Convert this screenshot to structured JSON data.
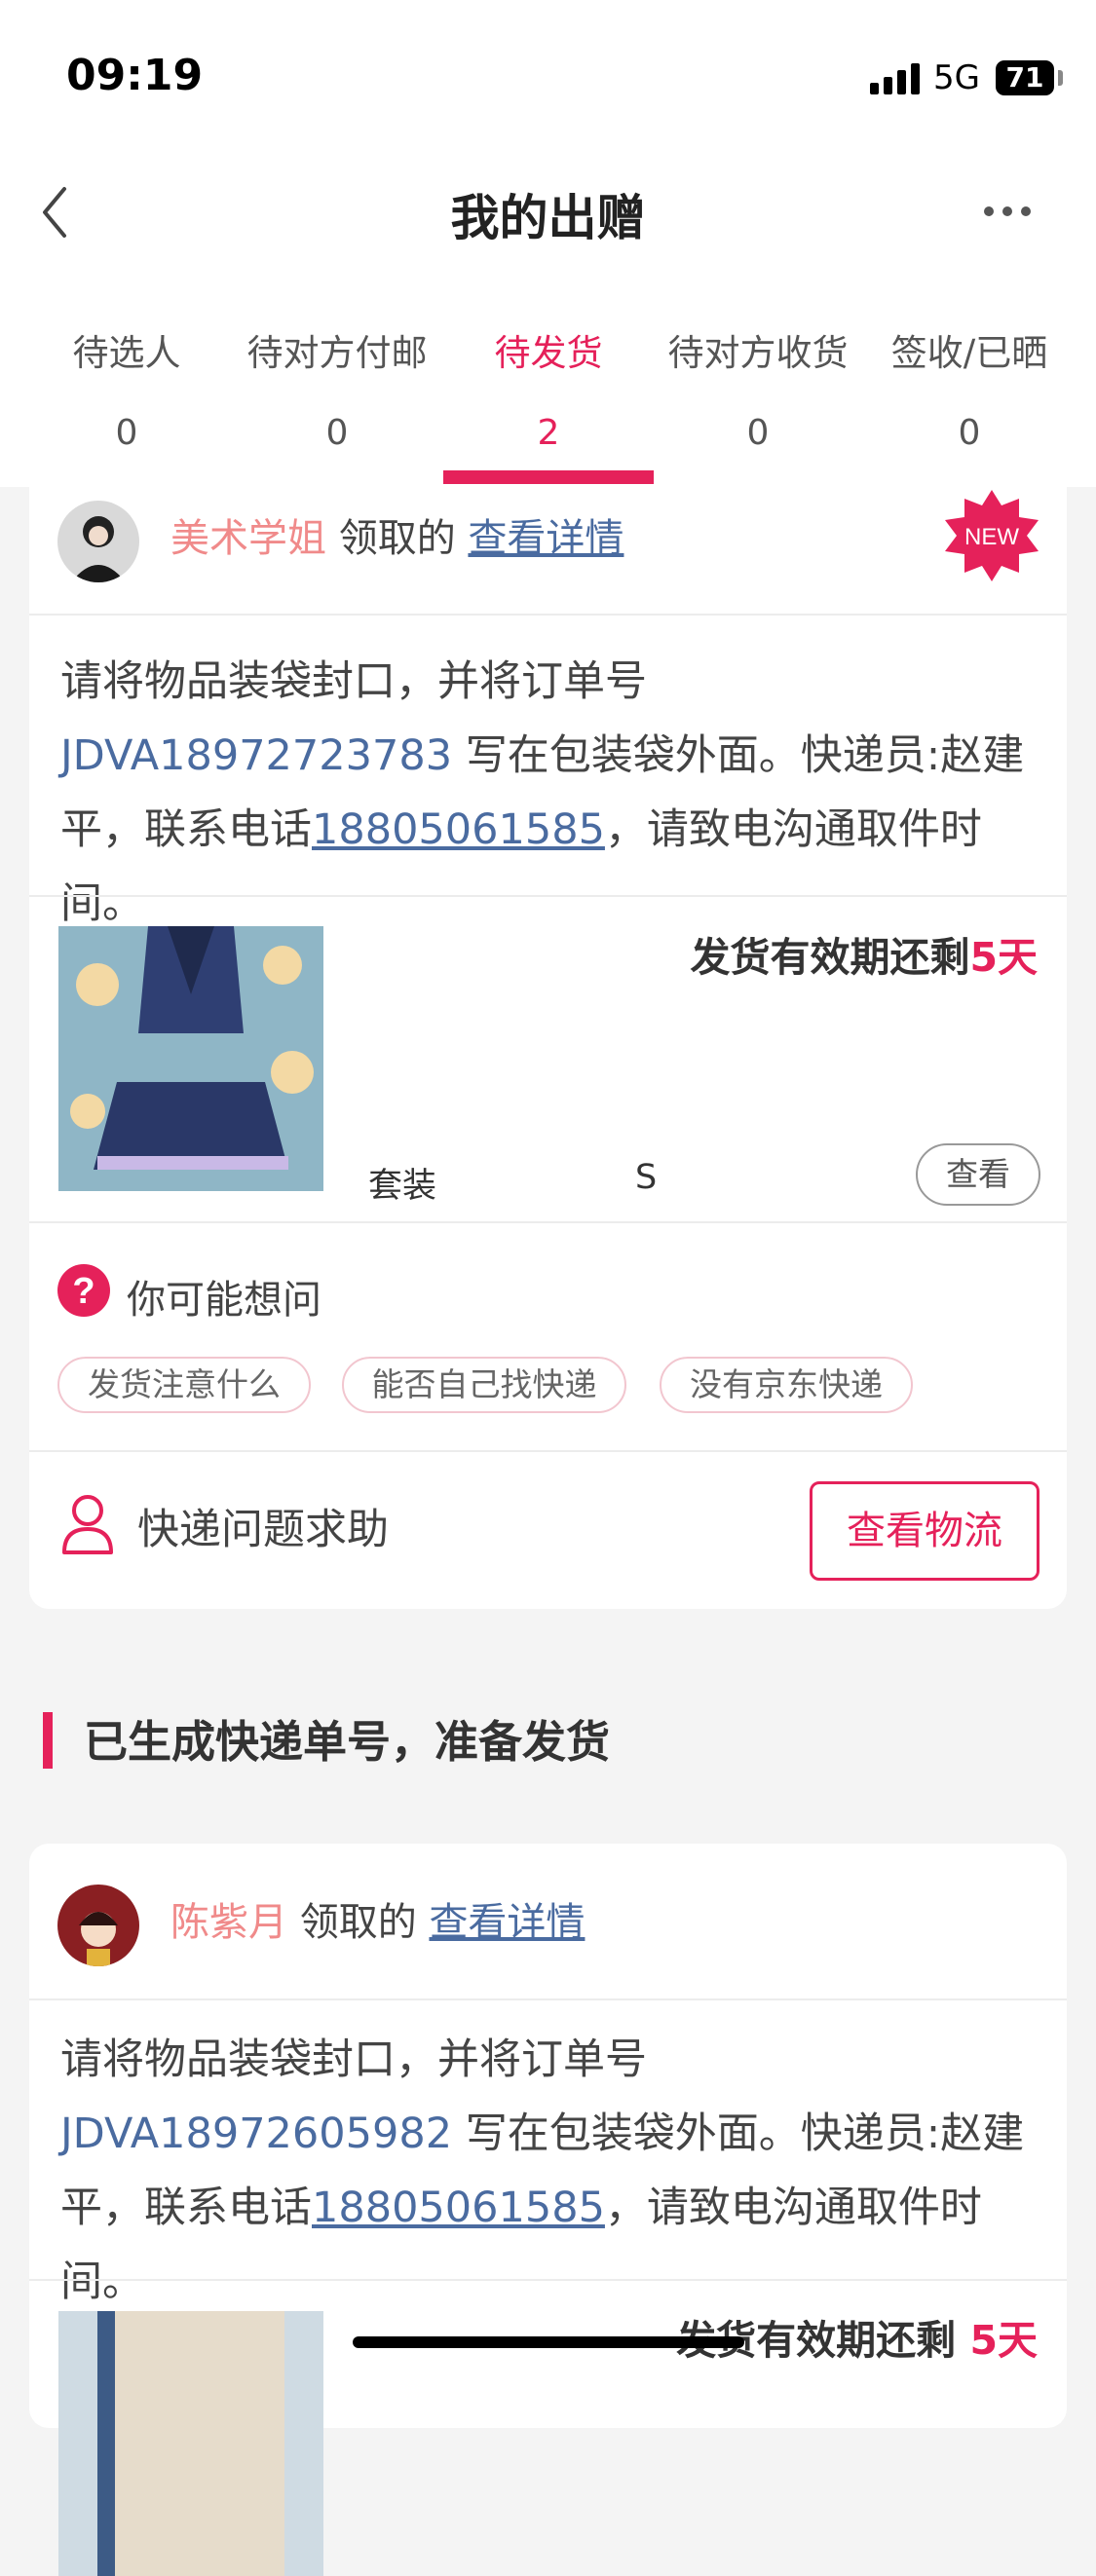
{
  "status_bar": {
    "time": "09:19",
    "network": "5G",
    "battery": "71"
  },
  "nav": {
    "title": "我的出赠",
    "back_icon": "chevron-left-icon",
    "more_icon": "ellipsis-icon"
  },
  "tabs": [
    {
      "label": "待选人",
      "count": "0"
    },
    {
      "label": "待对方付邮",
      "count": "0"
    },
    {
      "label": "待发货",
      "count": "2",
      "active": true
    },
    {
      "label": "待对方收货",
      "count": "0"
    },
    {
      "label": "签收/已晒",
      "count": "0"
    }
  ],
  "card1": {
    "claimer": "美术学姐",
    "claimed_text": "领取的",
    "details_link": "查看详情",
    "badge": "NEW",
    "instruction": {
      "prefix": "请将物品装袋封口，并将订单号 ",
      "order_no": "JDVA18972723783",
      "middle": " 写在包装袋外面。快递员:赵建平，联系电话",
      "phone": "18805061585",
      "suffix": "，请致电沟通取件时间。"
    },
    "deadline_prefix": "发货有效期还剩",
    "deadline_days": "5天",
    "item_type": "套装",
    "item_size": "S",
    "view_button": "查看",
    "faq_title": "你可能想问",
    "faq_chips": [
      "发货注意什么",
      "能否自己找快递",
      "没有京东快递"
    ],
    "help_label": "快递问题求助",
    "logistics_button": "查看物流"
  },
  "section_title": "已生成快递单号，准备发货",
  "card2": {
    "claimer": "陈紫月",
    "claimed_text": "领取的",
    "details_link": "查看详情",
    "instruction": {
      "prefix": "请将物品装袋封口，并将订单号 ",
      "order_no": "JDVA18972605982",
      "middle": " 写在包装袋外面。快递员:赵建平，联系电话",
      "phone": "18805061585",
      "suffix": "，请致电沟通取件时间。"
    },
    "deadline_prefix": "发货有效期还剩 ",
    "deadline_days": "5天"
  },
  "colors": {
    "accent": "#e5215a",
    "link": "#4a6ba0",
    "claimer": "#f08a8a",
    "background": "#f4f4f4"
  }
}
